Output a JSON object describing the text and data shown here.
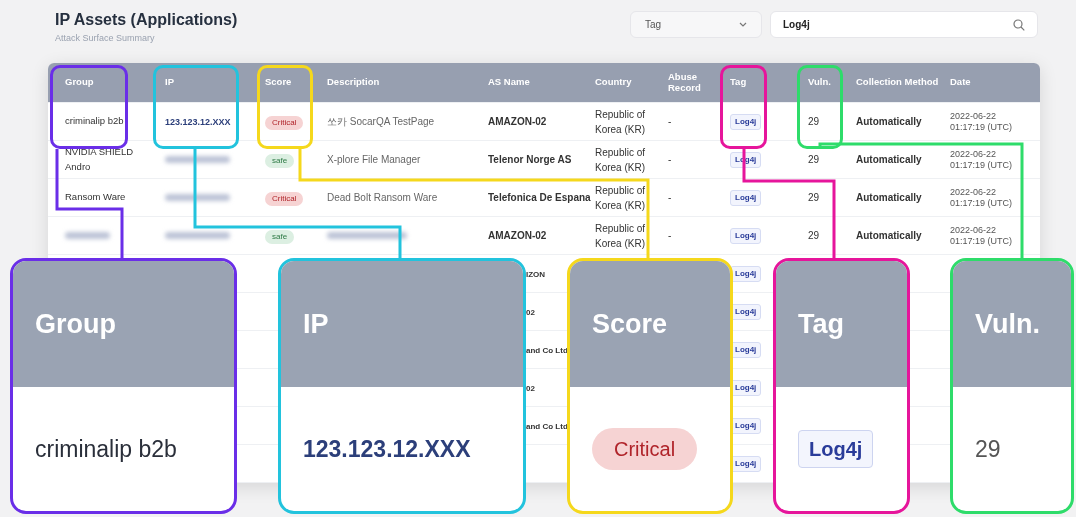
{
  "header": {
    "title": "IP Assets (Applications)",
    "subtitle": "Attack Surface Summary"
  },
  "filters": {
    "tag_select": {
      "value": "Tag"
    },
    "search": {
      "value": "Log4j"
    }
  },
  "table": {
    "columns": [
      "Group",
      "IP",
      "Score",
      "Description",
      "AS Name",
      "Country",
      "Abuse Record",
      "Tag",
      "Vuln.",
      "Collection Method",
      "Date"
    ],
    "rows": [
      {
        "blurred_group": false,
        "blurred_ip": false,
        "blurred_description": false,
        "group": "criminalip b2b",
        "ip": "123.123.12.XXX",
        "score": {
          "label": "Critical",
          "kind": "critical"
        },
        "description": "쏘카 SocarQA TestPage",
        "as_name": "AMAZON-02",
        "country": "Republic of Korea (KR)",
        "abuse": "-",
        "tag": "Log4j",
        "vuln": "29",
        "method": "Automatically",
        "date": "2022-06-22 01:17:19 (UTC)"
      },
      {
        "blurred_group": false,
        "blurred_ip": true,
        "blurred_description": false,
        "group": "NVIDIA SHIELD Andro",
        "score": {
          "label": "safe",
          "kind": "safe"
        },
        "description": "X-plore File Manager",
        "as_name": "Telenor Norge AS",
        "country": "Republic of Korea (KR)",
        "abuse": "-",
        "tag": "Log4j",
        "vuln": "29",
        "method": "Automatically",
        "date": "2022-06-22 01:17:19 (UTC)"
      },
      {
        "blurred_group": false,
        "blurred_ip": true,
        "blurred_description": false,
        "group": "Ransom Ware",
        "score": {
          "label": "Critical",
          "kind": "critical"
        },
        "description": "Dead Bolt Ransom Ware",
        "as_name": "Telefonica De Espana",
        "country": "Republic of Korea (KR)",
        "abuse": "-",
        "tag": "Log4j",
        "vuln": "29",
        "method": "Automatically",
        "date": "2022-06-22 01:17:19 (UTC)"
      },
      {
        "blurred_group": true,
        "blurred_ip": true,
        "blurred_description": true,
        "score": {
          "label": "safe",
          "kind": "safe"
        },
        "as_name": "AMAZON-02",
        "country": "Republic of Korea (KR)",
        "abuse": "-",
        "tag": "Log4j",
        "vuln": "29",
        "method": "Automatically",
        "date": "2022-06-22 01:17:19 (UTC)"
      },
      {
        "blurred_group": false,
        "blurred_ip": false,
        "blurred_description": false,
        "as_name": "IZON",
        "tag": "Log4j"
      },
      {
        "blurred_group": false,
        "blurred_ip": false,
        "blurred_description": false,
        "as_name": "02",
        "tag": "Log4j"
      },
      {
        "blurred_group": false,
        "blurred_ip": false,
        "blurred_description": false,
        "as_name": "and Co Ltd",
        "tag": "Log4j"
      },
      {
        "blurred_group": false,
        "blurred_ip": false,
        "blurred_description": false,
        "as_name": "02",
        "tag": "Log4j"
      },
      {
        "blurred_group": false,
        "blurred_ip": false,
        "blurred_description": false,
        "as_name": "and Co Ltd",
        "tag": "Log4j"
      },
      {
        "blurred_group": false,
        "blurred_ip": false,
        "blurred_description": false,
        "tag": "Log4j"
      }
    ]
  },
  "callouts": [
    {
      "heading": "Group",
      "value": "criminalip b2b",
      "kind": "text",
      "color": "#6a2ee8"
    },
    {
      "heading": "IP",
      "value": "123.123.12.XXX",
      "kind": "ip",
      "color": "#22c3dd"
    },
    {
      "heading": "Score",
      "value": "Critical",
      "kind": "badge",
      "color": "#f5d81c"
    },
    {
      "heading": "Tag",
      "value": "Log4j",
      "kind": "tag",
      "color": "#e6159b"
    },
    {
      "heading": "Vuln.",
      "value": "29",
      "kind": "number",
      "color": "#2edc6a"
    }
  ]
}
